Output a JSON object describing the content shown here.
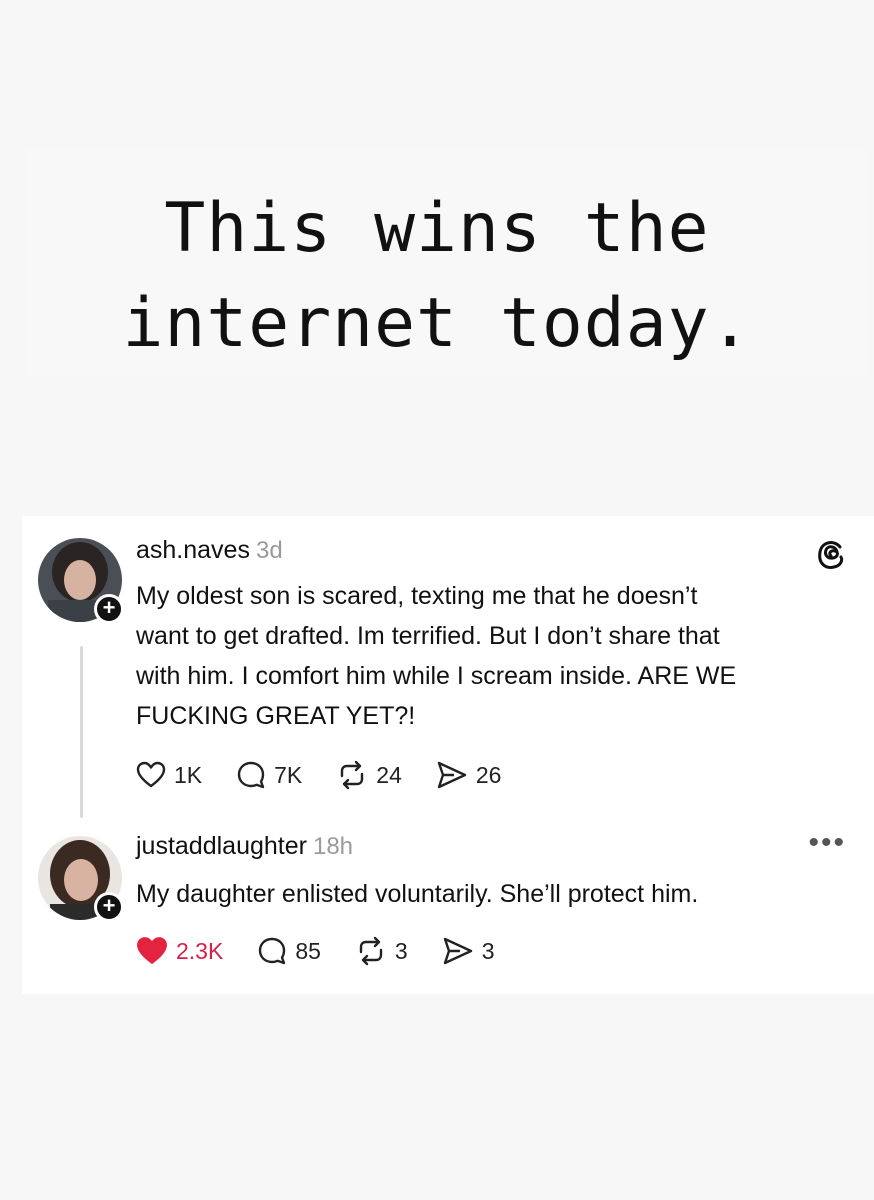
{
  "headline": {
    "line1": "This wins the",
    "line2": "internet today."
  },
  "posts": [
    {
      "username": "ash.naves",
      "time": "3d",
      "text_lines": [
        "My oldest son is scared, texting me that he doesn’t",
        "want to get drafted. Im terrified. But I don’t share that",
        "with him. I comfort him while I scream inside. ARE WE",
        "FUCKING GREAT YET?!"
      ],
      "likes": "1K",
      "replies": "7K",
      "reposts": "24",
      "shares": "26",
      "liked": false
    },
    {
      "username": "justaddlaughter",
      "time": "18h",
      "text_lines": [
        "My daughter enlisted voluntarily. She’ll protect him."
      ],
      "likes": "2.3K",
      "replies": "85",
      "reposts": "3",
      "shares": "3",
      "liked": true
    }
  ],
  "icons": {
    "like": "heart-icon",
    "reply": "comment-icon",
    "repost": "repost-icon",
    "share": "send-icon",
    "brand": "threads-logo-icon",
    "more": "more-options-icon"
  },
  "colors": {
    "liked": "#d6204a",
    "text": "#111111",
    "muted": "#9a9a9a"
  }
}
